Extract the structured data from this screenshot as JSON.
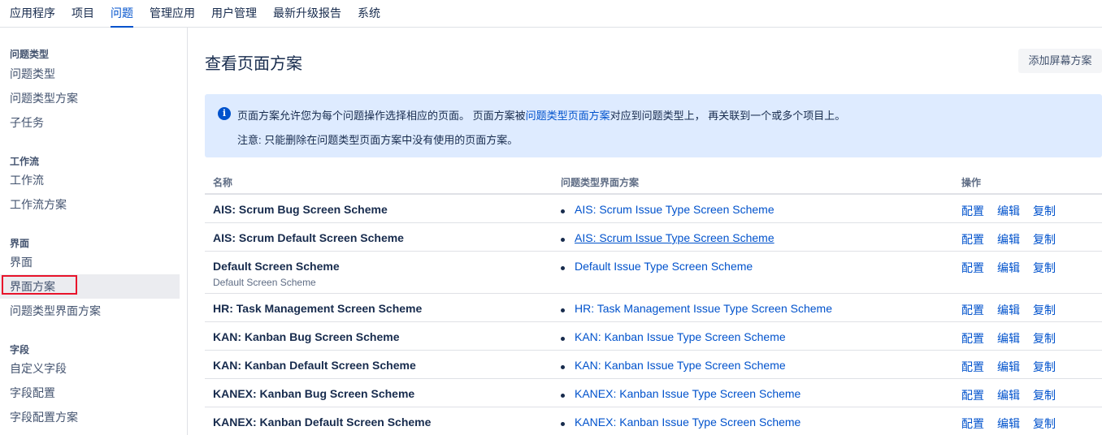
{
  "topnav": {
    "tabs": [
      {
        "label": "应用程序"
      },
      {
        "label": "项目"
      },
      {
        "label": "问题"
      },
      {
        "label": "管理应用"
      },
      {
        "label": "用户管理"
      },
      {
        "label": "最新升级报告"
      },
      {
        "label": "系统"
      }
    ],
    "active": "问题"
  },
  "sidebar": {
    "groups": [
      {
        "heading": "问题类型",
        "items": [
          "问题类型",
          "问题类型方案",
          "子任务"
        ]
      },
      {
        "heading": "工作流",
        "items": [
          "工作流",
          "工作流方案"
        ]
      },
      {
        "heading": "界面",
        "items": [
          "界面",
          "界面方案",
          "问题类型界面方案"
        ]
      },
      {
        "heading": "字段",
        "items": [
          "自定义字段",
          "字段配置",
          "字段配置方案"
        ]
      }
    ],
    "selected": "界面方案"
  },
  "main": {
    "title": "查看页面方案",
    "add_button": "添加屏幕方案",
    "info": {
      "line1_before": "页面方案允许您为每个问题操作选择相应的页面。 页面方案被",
      "line1_link": "问题类型页面方案",
      "line1_after": "对应到问题类型上， 再关联到一个或多个项目上。",
      "line2": "注意: 只能删除在问题类型页面方案中没有使用的页面方案。"
    },
    "table": {
      "headers": {
        "name": "名称",
        "scheme": "问题类型界面方案",
        "ops": "操作"
      },
      "op_labels": {
        "configure": "配置",
        "edit": "编辑",
        "copy": "复制"
      },
      "rows": [
        {
          "name": "AIS: Scrum Bug Screen Scheme",
          "desc": "",
          "scheme": "AIS: Scrum Issue Type Screen Scheme"
        },
        {
          "name": "AIS: Scrum Default Screen Scheme",
          "desc": "",
          "scheme": "AIS: Scrum Issue Type Screen Scheme"
        },
        {
          "name": "Default Screen Scheme",
          "desc": "Default Screen Scheme",
          "scheme": "Default Issue Type Screen Scheme"
        },
        {
          "name": "HR: Task Management Screen Scheme",
          "desc": "",
          "scheme": "HR: Task Management Issue Type Screen Scheme"
        },
        {
          "name": "KAN: Kanban Bug Screen Scheme",
          "desc": "",
          "scheme": "KAN: Kanban Issue Type Screen Scheme"
        },
        {
          "name": "KAN: Kanban Default Screen Scheme",
          "desc": "",
          "scheme": "KAN: Kanban Issue Type Screen Scheme"
        },
        {
          "name": "KANEX: Kanban Bug Screen Scheme",
          "desc": "",
          "scheme": "KANEX: Kanban Issue Type Screen Scheme"
        },
        {
          "name": "KANEX: Kanban Default Screen Scheme",
          "desc": "",
          "scheme": "KANEX: Kanban Issue Type Screen Scheme"
        }
      ]
    }
  }
}
